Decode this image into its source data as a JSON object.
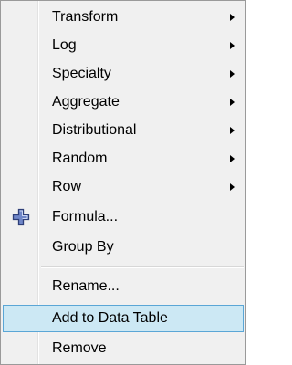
{
  "menu": {
    "items": [
      {
        "label": "Transform",
        "submenu": true
      },
      {
        "label": "Log",
        "submenu": true
      },
      {
        "label": "Specialty",
        "submenu": true
      },
      {
        "label": "Aggregate",
        "submenu": true
      },
      {
        "label": "Distributional",
        "submenu": true
      },
      {
        "label": "Random",
        "submenu": true
      },
      {
        "label": "Row",
        "submenu": true
      },
      {
        "label": "Formula...",
        "icon": "plus-icon"
      },
      {
        "label": "Group By"
      },
      {
        "label": "Rename..."
      },
      {
        "label": "Add to Data Table",
        "highlighted": true
      },
      {
        "label": "Remove"
      }
    ]
  },
  "colors": {
    "menu_background": "#f0f0f0",
    "highlight_background": "#cce8f4",
    "highlight_border": "#5aa6d6",
    "plus_icon": "#3c4f8a"
  }
}
